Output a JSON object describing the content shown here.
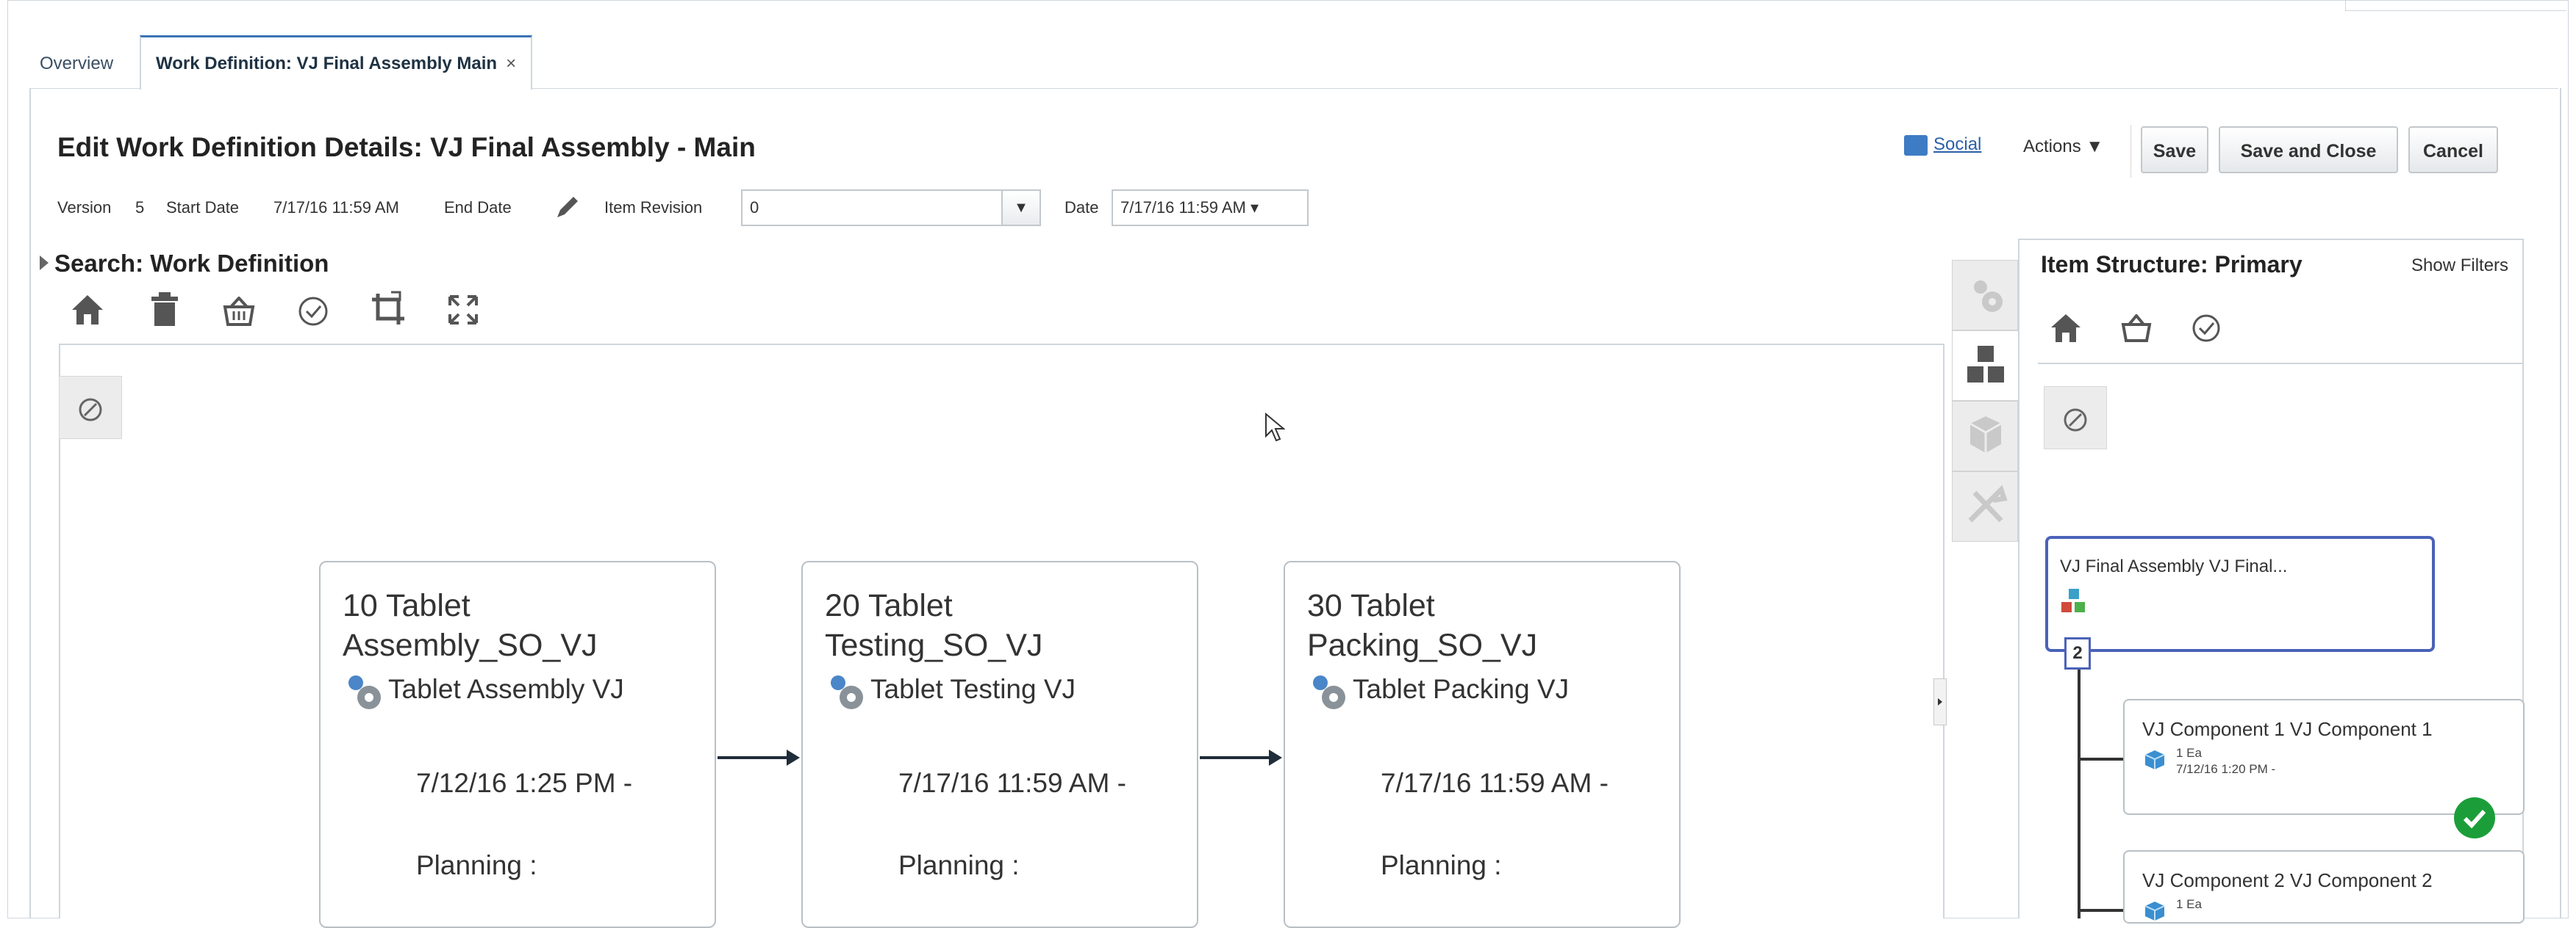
{
  "tabs": {
    "overview": "Overview",
    "work_definition": "Work Definition: VJ Final Assembly Main",
    "close_glyph": "×"
  },
  "header": {
    "title": "Edit Work Definition Details: VJ Final Assembly - Main",
    "social": "Social",
    "actions": "Actions ▼",
    "save": "Save",
    "save_and_close": "Save and Close",
    "cancel": "Cancel"
  },
  "info": {
    "version_label": "Version",
    "version_value": "5",
    "start_date_label": "Start Date",
    "start_date_value": "7/17/16 11:59 AM",
    "end_date_label": "End Date",
    "item_revision_label": "Item Revision",
    "item_revision_value": "0",
    "date_label": "Date",
    "date_value": "7/17/16 11:59 AM ▾"
  },
  "search": {
    "title": "Search: Work Definition",
    "icons": [
      "home-icon",
      "trash-icon",
      "basket-icon",
      "check-circle-icon",
      "crop-icon",
      "expand-icon"
    ]
  },
  "operations": [
    {
      "title": "10 Tablet Assembly_SO_VJ",
      "resource": "Tablet Assembly VJ",
      "date": "7/12/16 1:25 PM -",
      "planning": "Planning :"
    },
    {
      "title": "20 Tablet Testing_SO_VJ",
      "resource": "Tablet Testing VJ",
      "date": "7/17/16 11:59 AM -",
      "planning": "Planning :"
    },
    {
      "title": "30 Tablet Packing_SO_VJ",
      "resource": "Tablet Packing VJ",
      "date": "7/17/16 11:59 AM -",
      "planning": "Planning :"
    }
  ],
  "item_structure": {
    "title": "Item Structure: Primary",
    "show_filters": "Show Filters",
    "root": "VJ Final Assembly VJ Final...",
    "count": "2",
    "children": [
      {
        "title": "VJ Component 1 VJ Component 1",
        "qty": "1 Ea",
        "date": "7/12/16 1:20 PM -",
        "checked": true
      },
      {
        "title": "VJ Component 2 VJ Component 2",
        "qty": "1 Ea",
        "date": "",
        "checked": false
      }
    ]
  },
  "colors": {
    "accent": "#3a73b6",
    "node_border": "#4a62b8",
    "check": "#1b9e3a",
    "arrow": "#1f2d3a"
  }
}
